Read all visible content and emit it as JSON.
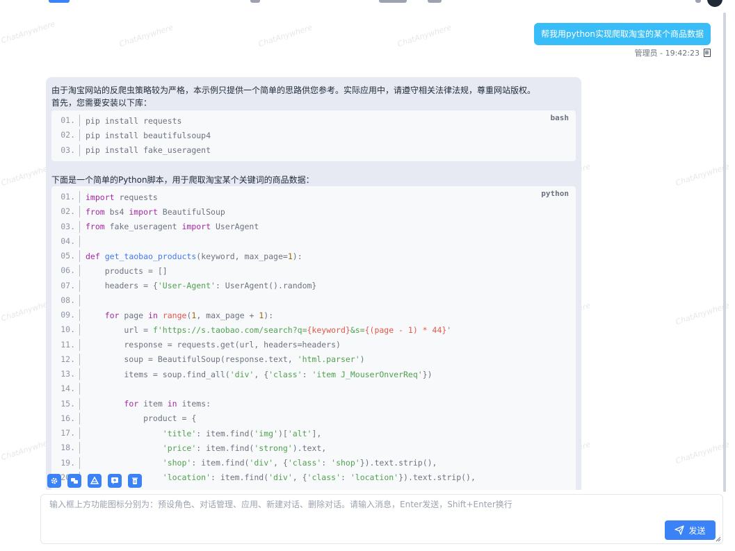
{
  "watermark_text": "ChatAnywhere",
  "user_message": {
    "text": "帮我用python实现爬取淘宝的某个商品数据",
    "meta": "管理员 - 19:42:23"
  },
  "assistant_message": {
    "intro_line1": "由于淘宝网站的反爬虫策略较为严格，本示例只提供一个简单的思路供您参考。实际应用中，请遵守相关法律法规，尊重网站版权。",
    "intro_line2": "首先，您需要安装以下库：",
    "bash_block": {
      "lang": "bash",
      "lines": [
        {
          "no": "01.",
          "code": "pip install requests"
        },
        {
          "no": "02.",
          "code": "pip install beautifulsoup4"
        },
        {
          "no": "03.",
          "code": "pip install fake_useragent"
        }
      ]
    },
    "middle_text": "下面是一个简单的Python脚本，用于爬取淘宝某个关键词的商品数据：",
    "python_block": {
      "lang": "python",
      "line_numbers": [
        "01.",
        "02.",
        "03.",
        "04.",
        "05.",
        "06.",
        "07.",
        "08.",
        "09.",
        "10.",
        "11.",
        "12.",
        "13.",
        "14.",
        "15.",
        "16.",
        "17.",
        "18.",
        "19.",
        "20."
      ]
    }
  },
  "toolbar": {
    "items": [
      "预设角色",
      "对话管理",
      "应用",
      "新建对话",
      "删除对话"
    ]
  },
  "input": {
    "placeholder": "输入框上方功能图标分别为：预设角色、对话管理、应用、新建对话、删除对话。请输入消息，Enter发送，Shift+Enter换行",
    "value": ""
  },
  "send_button": {
    "label": "发送"
  },
  "colors": {
    "accent": "#3b82f6",
    "user_bubble": "#38bdf8",
    "ai_bubble": "#e7eaf3"
  }
}
